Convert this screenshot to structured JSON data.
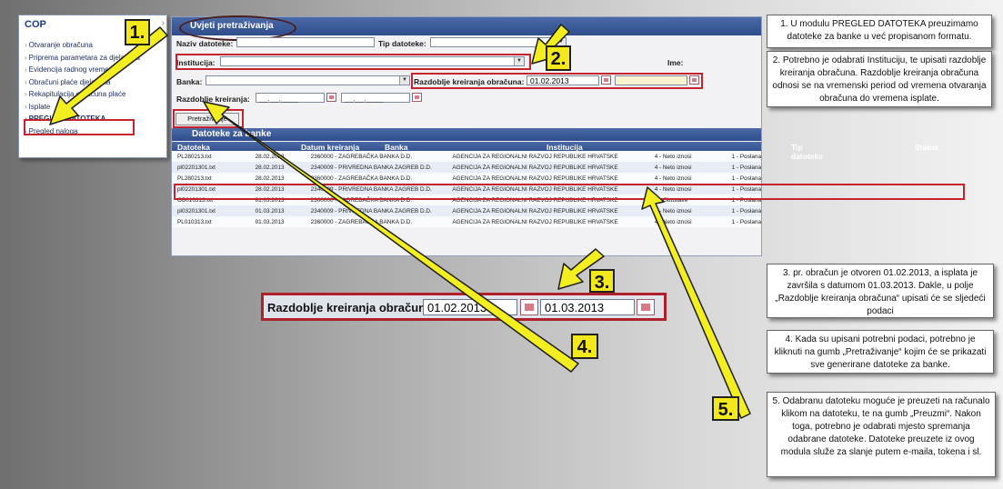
{
  "sidebar": {
    "title": "COP",
    "collapse_glyph": "›",
    "items": [
      {
        "label": "Otvaranje obračuna"
      },
      {
        "label": "Priprema parametara za djelatnika"
      },
      {
        "label": "Evidencija radnog vremena"
      },
      {
        "label": "Obračuni plaće djelatnika"
      },
      {
        "label": "Rekapitulacija obračuna plaće"
      },
      {
        "label": "Isplate"
      },
      {
        "label": "PREGLED DATOTEKA"
      },
      {
        "label": "Pregled naloga"
      }
    ]
  },
  "form": {
    "section_title": "Uvjeti pretraživanja",
    "naziv_label": "Naziv datoteke:",
    "naziv_value": "",
    "tip_label": "Tip datoteke:",
    "institucija_label": "Institucija:",
    "ime_label": "Ime:",
    "banka_label": "Banka:",
    "razdoblje_obracuna_label": "Razdoblje kreiranja obračuna:",
    "date_from": "01.02.2013",
    "date_to": "",
    "razdoblje_kreiranja_label": "Razdoblje kreiranja:",
    "kreiranja_from": "__.__.____",
    "kreiranja_to": "__.__.____",
    "search_button": "Pretraživanje"
  },
  "results": {
    "section_title": "Datoteke za banke",
    "columns": [
      "Datoteka",
      "Datum kreiranja",
      "Banka",
      "Institucija",
      "Tip datoteke",
      "Status"
    ],
    "rows": [
      [
        "PL280213.txt",
        "28.02.2013",
        "2360000 - ZAGREBAČKA BANKA D.D.",
        "AGENCIJA ZA REGIONALNI RAZVOJ REPUBLIKE HRVATSKE",
        "4 - Neto iznosi",
        "1 - Poslana"
      ],
      [
        "pl02201301.txt",
        "28.02.2013",
        "2340009 - PRIVREDNA BANKA ZAGREB D.D.",
        "AGENCIJA ZA REGIONALNI RAZVOJ REPUBLIKE HRVATSKE",
        "4 - Neto iznosi",
        "1 - Poslana"
      ],
      [
        "PL280213.txt",
        "28.02.2013",
        "2360000 - ZAGREBAČKA BANKA D.D.",
        "AGENCIJA ZA REGIONALNI RAZVOJ REPUBLIKE HRVATSKE",
        "4 - Neto iznosi",
        "1 - Poslana"
      ],
      [
        "pl02201301.txt",
        "28.02.2013",
        "2340009 - PRIVREDNA BANKA ZAGREB D.D.",
        "AGENCIJA ZA REGIONALNI RAZVOJ REPUBLIKE HRVATSKE",
        "4 - Neto iznosi",
        "1 - Poslana"
      ],
      [
        "OB010313.txt",
        "01.03.2013",
        "2360000 - ZAGREBAČKA BANKA D.D.",
        "AGENCIJA ZA REGIONALNI RAZVOJ REPUBLIKE HRVATSKE",
        "5 - Obustave",
        "1 - Poslana"
      ],
      [
        "pl03201301.txt",
        "01.03.2013",
        "2340009 - PRIVREDNA BANKA ZAGREB D.D.",
        "AGENCIJA ZA REGIONALNI RAZVOJ REPUBLIKE HRVATSKE",
        "4 - Neto iznosi",
        "1 - Poslana"
      ],
      [
        "PL010313.txt",
        "01.03.2013",
        "2360000 - ZAGREBAČKA BANKA D.D.",
        "AGENCIJA ZA REGIONALNI RAZVOJ REPUBLIKE HRVATSKE",
        "4 - Neto iznosi",
        "1 - Poslana"
      ]
    ]
  },
  "zoom": {
    "label": "Razdoblje kreiranja obračuna:",
    "from": "01.02.2013",
    "to": "01.03.2013"
  },
  "steps": [
    "1.",
    "2.",
    "3.",
    "4.",
    "5."
  ],
  "notes": {
    "n1": "1. U modulu PREGLED DATOTEKA preuzimamo datoteke za banke u već propisanom formatu.",
    "n2": "2. Potrebno je odabrati Instituciju, te upisati razdoblje kreiranja obračuna. Razdoblje kreiranja obračuna odnosi se na vremenski period od vremena otvaranja obračuna do vremena isplate.",
    "n3": "3. pr. obračun je otvoren 01.02.2013, a isplata je završila s datumom 01.03.2013. Dakle, u polje „Razdoblje kreiranja obračuna“ upisati će se sljedeći podaci",
    "n4": "4. Kada su upisani potrebni podaci, potrebno je kliknuti na gumb „Pretraživanje“ kojim će se prikazati sve generirane datoteke za banke.",
    "n5": "5. Odabranu datoteku moguće je preuzeti na računalo klikom na datoteku, te na gumb „Preuzmi“. Nakon toga, potrebno je odabrati mjesto spremanja odabrane datoteke. Datoteke preuzete iz ovog modula služe za slanje putem e-maila, tokena i sl."
  },
  "colors": {
    "highlight": "#c5242f",
    "arrow": "#f3ee1f",
    "header_bar": "#2f4c8c"
  },
  "icons": {
    "calendar": "calendar-icon",
    "dropdown": "chevron-down-icon"
  }
}
